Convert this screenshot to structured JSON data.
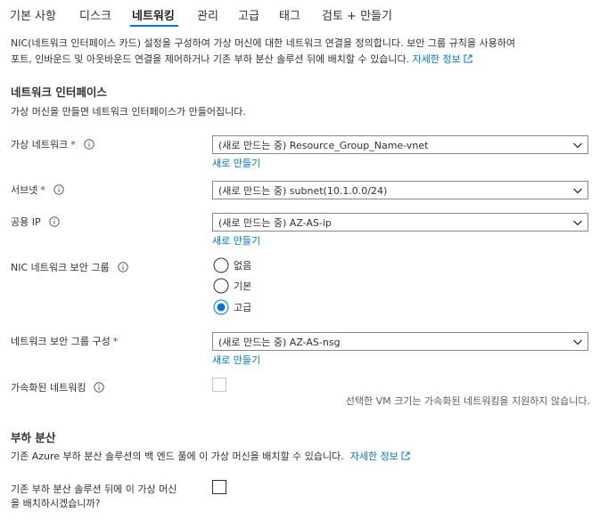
{
  "tabs": [
    {
      "label": "기본 사항"
    },
    {
      "label": "디스크"
    },
    {
      "label": "네트워킹"
    },
    {
      "label": "관리"
    },
    {
      "label": "고급"
    },
    {
      "label": "태그"
    },
    {
      "label": "검토 + 만들기"
    }
  ],
  "active_tab": "네트워킹",
  "intro": {
    "line1": "NIC(네트워크 인터페이스 카드) 설정을 구성하여 가상 머신에 대한 네트워크 연결을 정의합니다. 보안 그룹 규칙을 사용하여",
    "line2": "포트, 인바운드 및 아웃바운드 연결을 제어하거나 기존 부하 분산 솔루션 뒤에 배치할 수 있습니다.",
    "learn_more": "자세한 정보"
  },
  "nic_section": {
    "title": "네트워크 인터페이스",
    "description": "가상 머신을 만들면 네트워크 인터페이스가 만들어집니다."
  },
  "fields": {
    "vnet": {
      "label": "가상 네트워크",
      "required": "*",
      "value": "(새로 만드는 중) Resource_Group_Name-vnet",
      "create_new": "새로 만들기"
    },
    "subnet": {
      "label": "서브넷",
      "required": "*",
      "value": "(새로 만드는 중) subnet(10.1.0.0/24)"
    },
    "public_ip": {
      "label": "공용 IP",
      "value": "(새로 만드는 중) AZ-AS-ip",
      "create_new": "새로 만들기"
    },
    "nsg_type": {
      "label": "NIC 네트워크 보안 그룹",
      "options": [
        {
          "label": "없음",
          "selected": false
        },
        {
          "label": "기본",
          "selected": false
        },
        {
          "label": "고급",
          "selected": true
        }
      ]
    },
    "nsg_config": {
      "label": "네트워크 보안 그룹 구성",
      "required": "*",
      "value": "(새로 만드는 중) AZ-AS-nsg",
      "create_new": "새로 만들기"
    },
    "accel": {
      "label": "가속화된 네트워킹",
      "note": "선택한 VM 크기는 가속화된 네트워킹을 지원하지 않습니다."
    }
  },
  "lb_section": {
    "title": "부하 분산",
    "description": "기존 Azure 부하 분산 솔루션의 백 엔드 풀에 이 가상 머신을 배치할 수 있습니다.",
    "learn_more": "자세한 정보",
    "question_line1": "기존 부하 분산 솔루션 뒤에 이 가상 머신",
    "question_line2": "을 배치하시겠습니까?"
  },
  "colors": {
    "accent": "#0078d4",
    "required": "#a4262c",
    "border": "#8a8886"
  },
  "icons": [
    "info-icon",
    "chevron-down-icon",
    "external-link-icon"
  ]
}
